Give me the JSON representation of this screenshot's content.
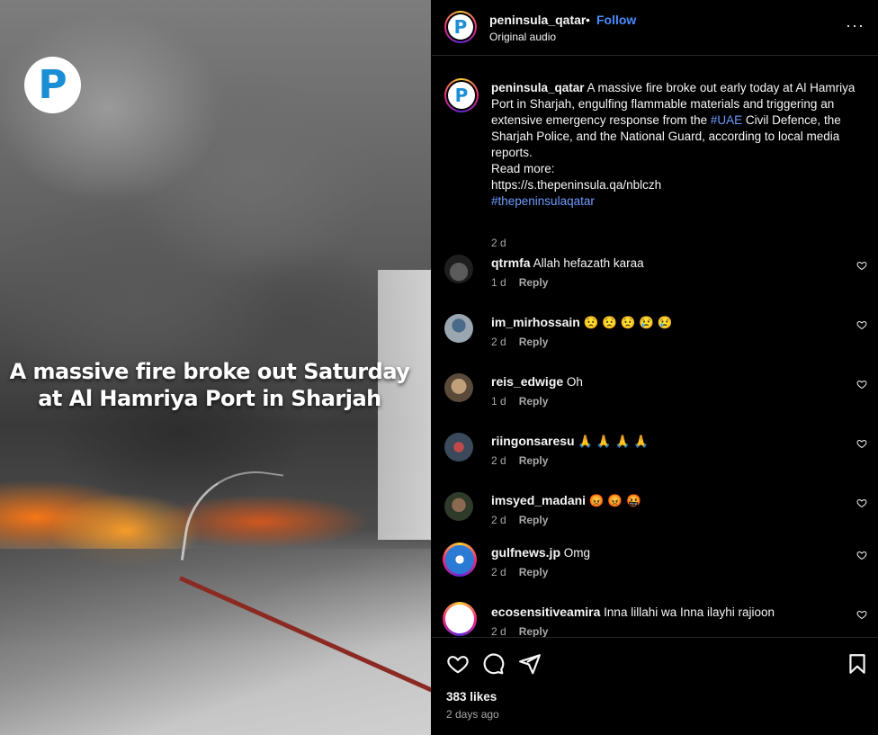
{
  "media": {
    "logo_letter": "P",
    "overlay_line1": "A massive fire broke out Saturday",
    "overlay_line2": "at Al Hamriya Port in Sharjah"
  },
  "header": {
    "username": "peninsula_qatar",
    "separator": "•",
    "follow_label": "Follow",
    "audio_label": "Original audio",
    "more_label": "···",
    "avatar_letter": "P"
  },
  "caption": {
    "username": "peninsula_qatar",
    "text_before": "A massive fire broke out early today at Al Hamriya Port in Sharjah, engulfing flammable materials and triggering an extensive emergency response from the ",
    "hashtag_inline": "#UAE",
    "text_after": " Civil Defence, the Sharjah Police, and the National Guard, according to local media reports.",
    "read_more": "Read more:",
    "link": "https://s.thepeninsula.qa/nblczh",
    "hashtag": "#thepeninsulaqatar",
    "time": "2 d"
  },
  "comments": [
    {
      "username": "qtrmfa",
      "text": "Allah hefazath karaa",
      "time": "1 d",
      "reply": "Reply",
      "avatar_color": "#3a3a3a"
    },
    {
      "username": "im_mirhossain",
      "text": "😟 😟 😟 😢 😢",
      "time": "2 d",
      "reply": "Reply",
      "avatar_color": "#6c7a8a"
    },
    {
      "username": "reis_edwige",
      "text": "Oh",
      "time": "1 d",
      "reply": "Reply",
      "avatar_color": "#a08a6e"
    },
    {
      "username": "riingonsaresu",
      "text": "🙏 🙏 🙏 🙏",
      "time": "2 d",
      "reply": "Reply",
      "avatar_color": "#8a4a4a"
    },
    {
      "username": "imsyed_madani",
      "text": "😡 😡 🤬",
      "time": "2 d",
      "reply": "Reply",
      "avatar_color": "#6a5040"
    },
    {
      "username": "gulfnews.jp",
      "text": "Omg",
      "time": "2 d",
      "reply": "Reply",
      "avatar_color": "#2a7ad6"
    },
    {
      "username": "ecosensitiveamira",
      "text": "Inna lillahi wa Inna ilayhi rajioon",
      "time": "2 d",
      "reply": "Reply",
      "avatar_color": "#ffffff"
    }
  ],
  "actions": {
    "likes": "383 likes",
    "posted": "2 days ago"
  },
  "icons": [
    "heart-icon",
    "comment-icon",
    "share-icon",
    "bookmark-icon",
    "more-options-icon"
  ],
  "colors": {
    "accent_link": "#4a8bff",
    "hashtag": "#6f9bff",
    "muted": "#a8a8a8",
    "logo_blue": "#1b8fd6"
  }
}
